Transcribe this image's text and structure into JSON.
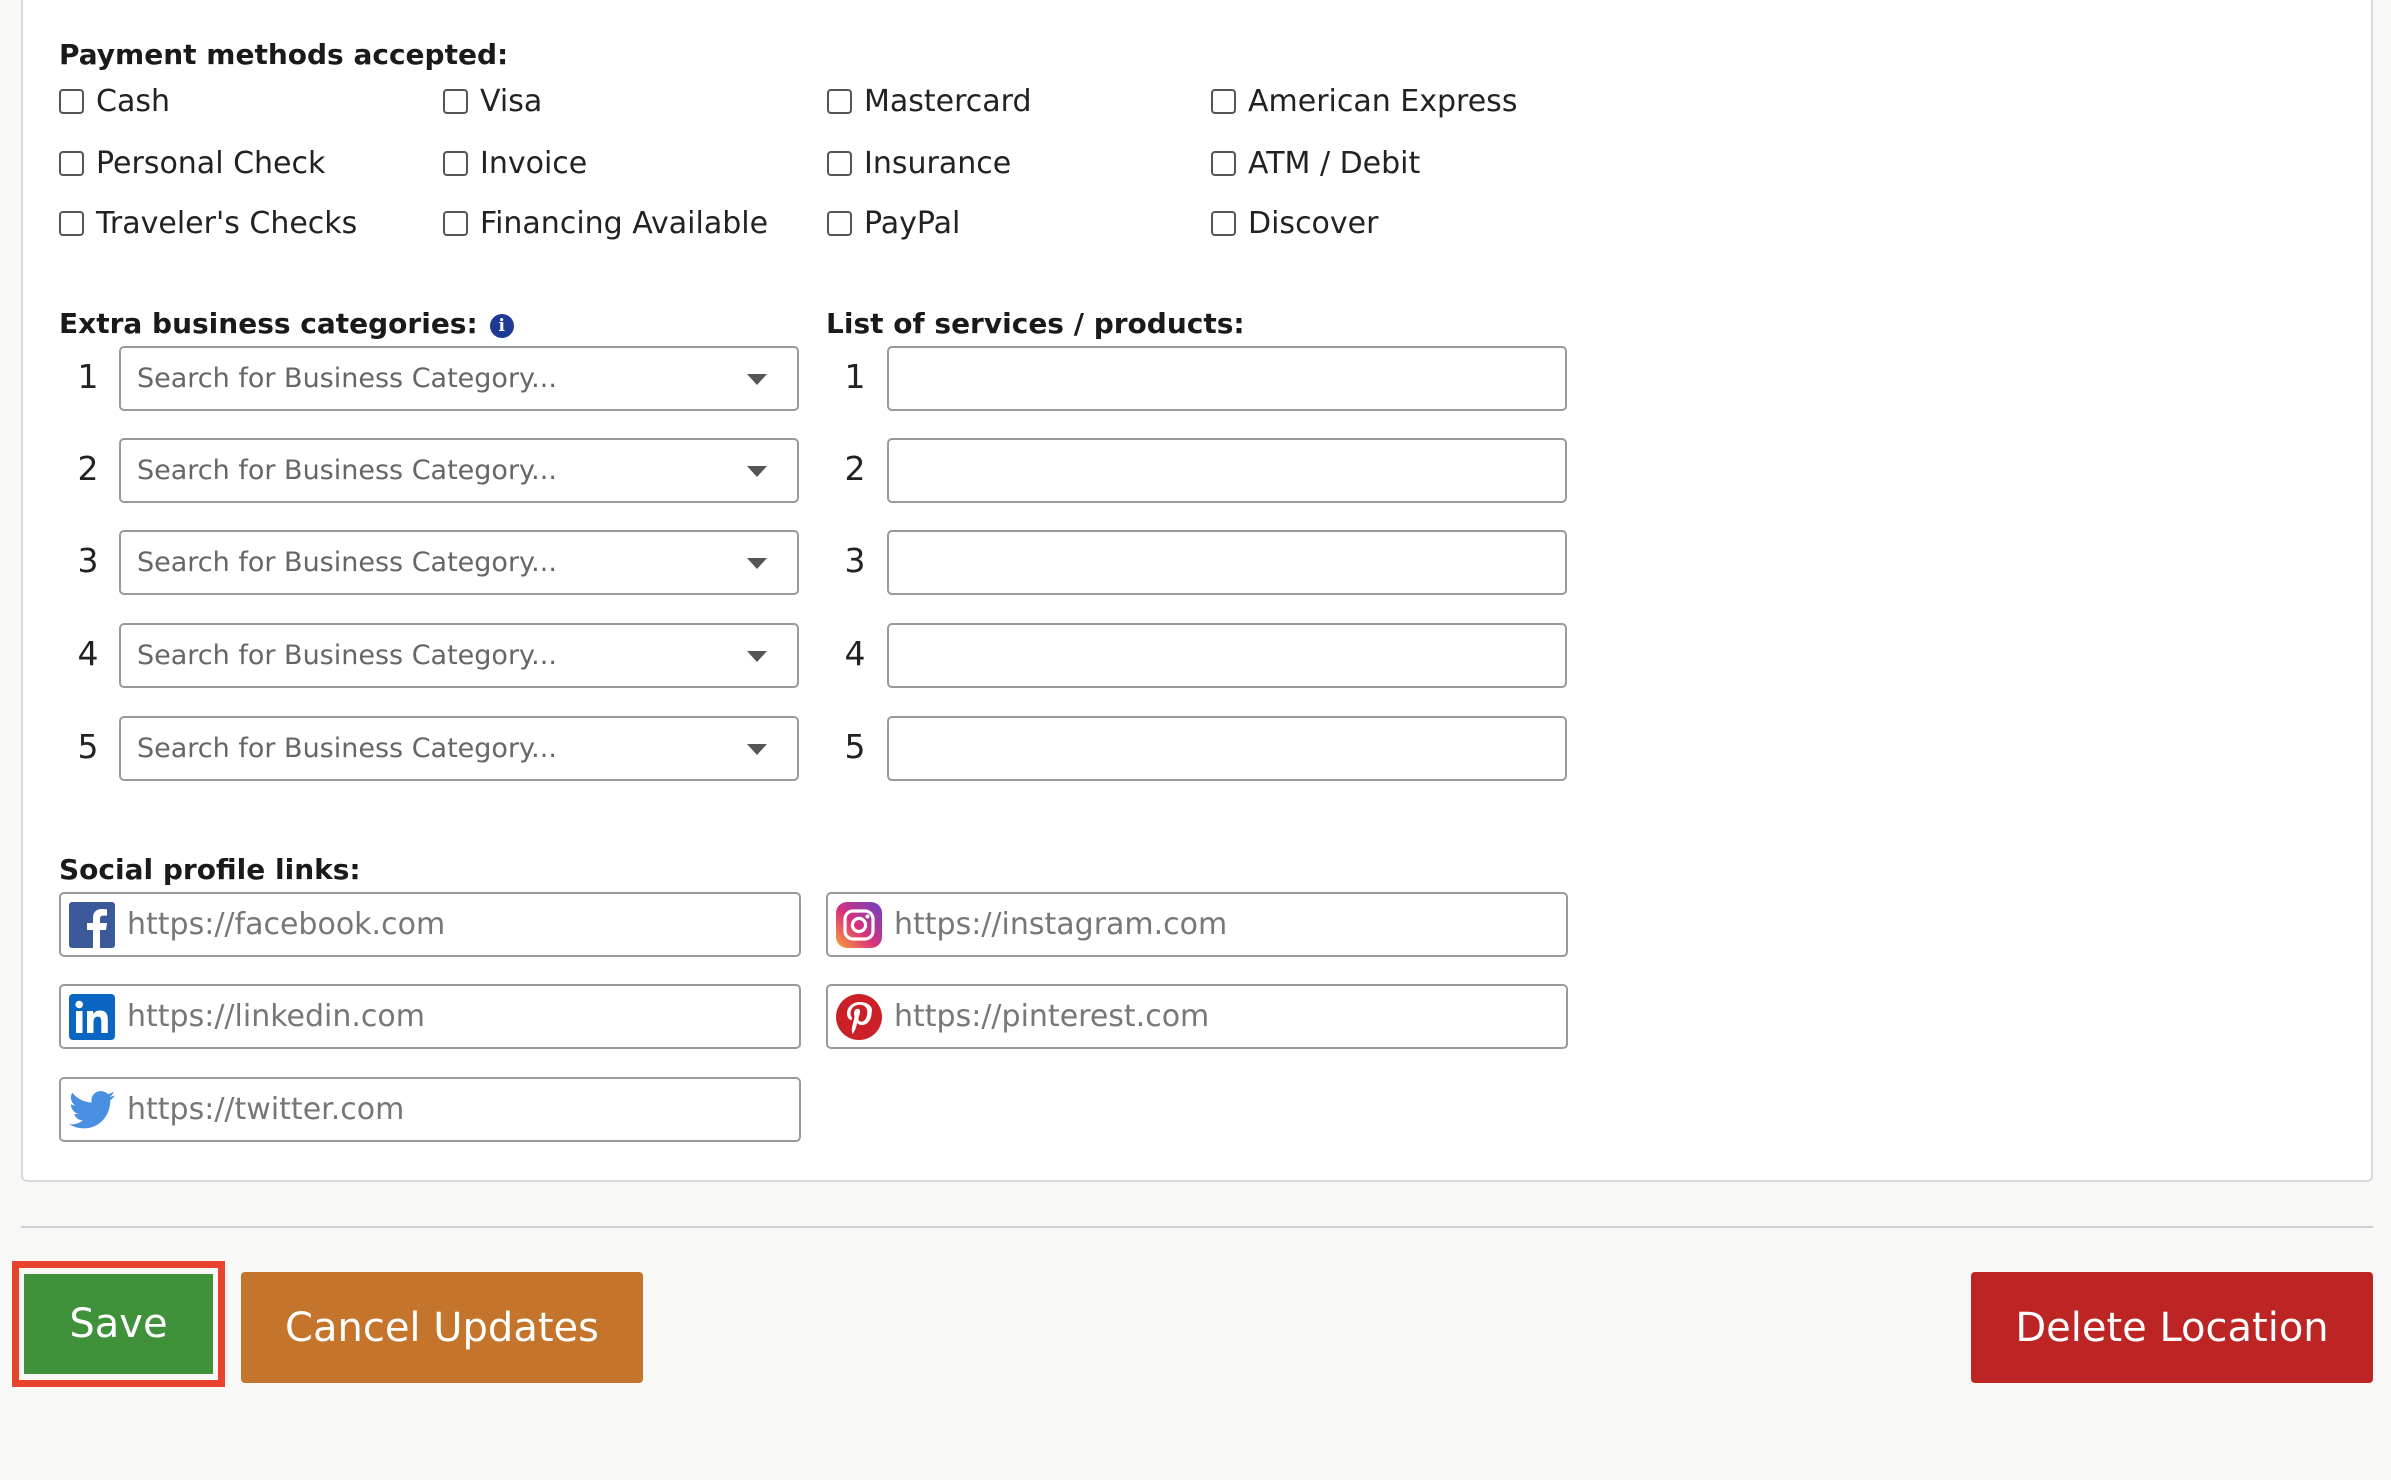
{
  "payment": {
    "label": "Payment methods accepted:",
    "options": [
      "Cash",
      "Visa",
      "Mastercard",
      "American Express",
      "Personal Check",
      "Invoice",
      "Insurance",
      "ATM / Debit",
      "Traveler's Checks",
      "Financing Available",
      "PayPal",
      "Discover"
    ]
  },
  "categories": {
    "label": "Extra business categories:",
    "info_icon": "info-icon",
    "rows": [
      "1",
      "2",
      "3",
      "4",
      "5"
    ],
    "placeholder": "Search for Business Category..."
  },
  "services": {
    "label": "List of services / products:",
    "rows": [
      "1",
      "2",
      "3",
      "4",
      "5"
    ]
  },
  "social": {
    "label": "Social profile links:",
    "facebook": "https://facebook.com",
    "instagram": "https://instagram.com",
    "linkedin": "https://linkedin.com",
    "pinterest": "https://pinterest.com",
    "twitter": "https://twitter.com"
  },
  "actions": {
    "save": "Save",
    "cancel": "Cancel Updates",
    "delete": "Delete Location"
  },
  "colors": {
    "save": "#3f913a",
    "cancel": "#c5742b",
    "delete": "#bd2424",
    "highlight": "#e8432d"
  }
}
